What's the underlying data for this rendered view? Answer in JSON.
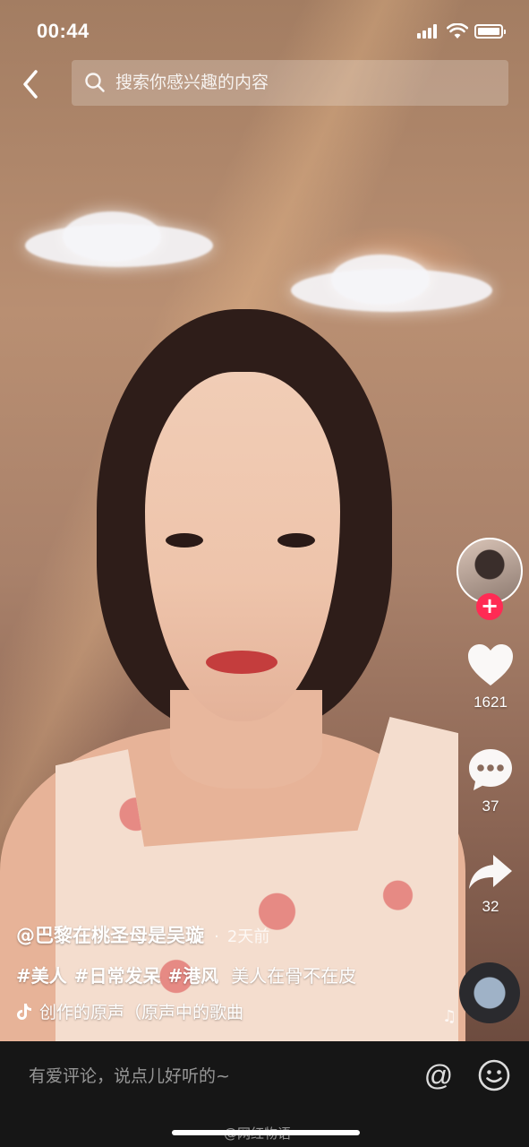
{
  "status_bar": {
    "time": "00:44"
  },
  "search": {
    "placeholder": "搜索你感兴趣的内容"
  },
  "right_rail": {
    "likes": "1621",
    "comments": "37",
    "shares": "32"
  },
  "caption": {
    "author": "@巴黎在桃圣母是吴璇",
    "separator": "·",
    "time_ago": "2天前",
    "tags": [
      "#美人",
      "#日常发呆",
      "#港风"
    ],
    "description": "美人在骨不在皮",
    "music": "创作的原声（原声中的歌曲"
  },
  "comment_bar": {
    "placeholder": "有爱评论，说点儿好听的~",
    "at_symbol": "@"
  },
  "watermark": "@网红物语",
  "colors": {
    "follow_accent": "#ff2b54",
    "comment_bar_bg": "#161616"
  }
}
